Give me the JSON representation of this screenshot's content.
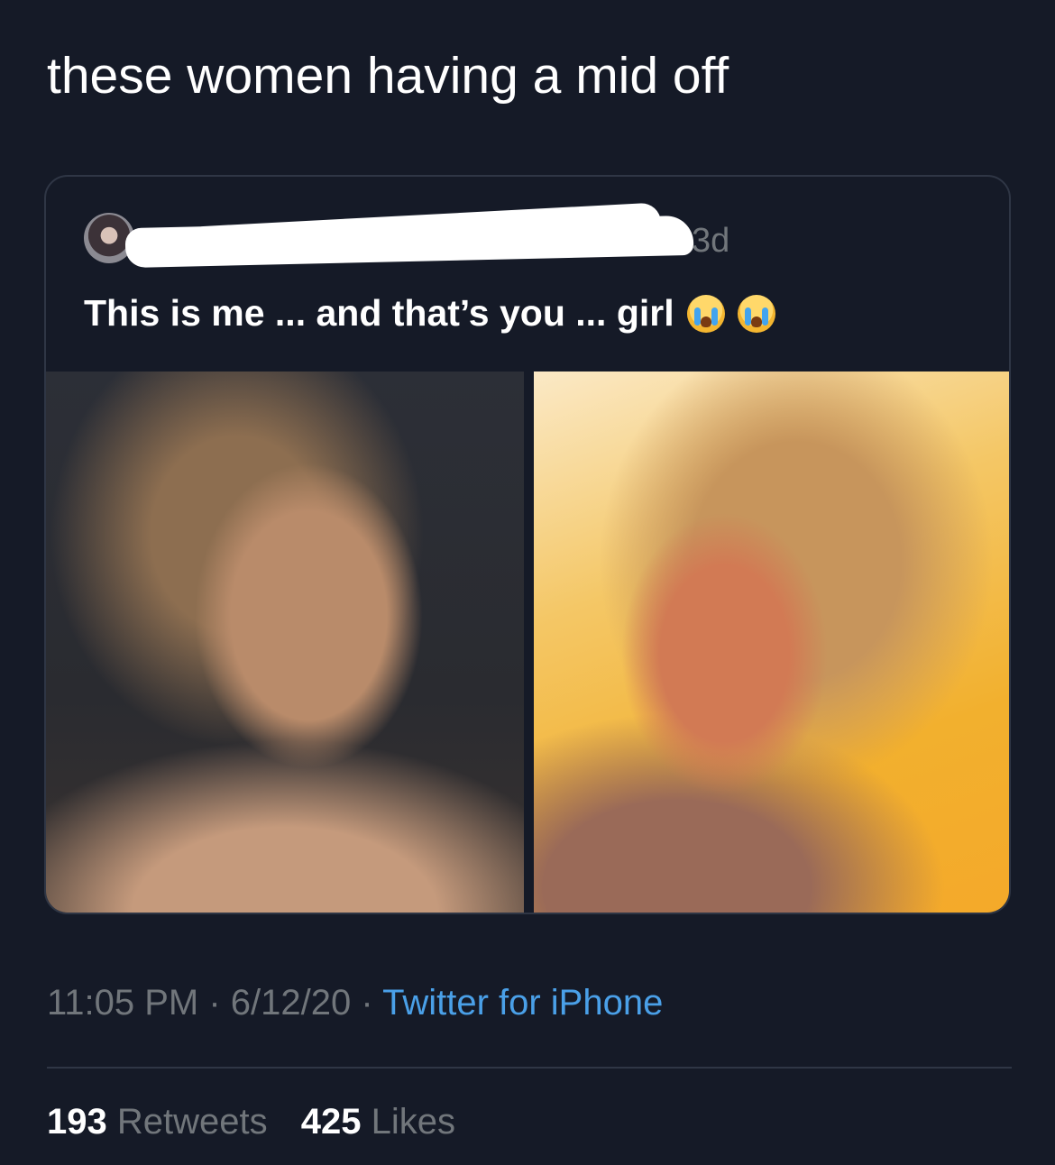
{
  "tweet": {
    "text": "these women having a mid off",
    "time": "11:05 PM",
    "date": "6/12/20",
    "source": "Twitter for iPhone",
    "separator": " · ",
    "retweets_count": "193",
    "retweets_label": "Retweets",
    "likes_count": "425",
    "likes_label": "Likes"
  },
  "quote_tweet": {
    "time_ago": "3d",
    "text": "This is me ... and that’s you ... girl",
    "emojis": [
      "loudly-crying-face-icon",
      "loudly-crying-face-icon"
    ],
    "author_name_redacted": true
  },
  "colors": {
    "background": "#151a27",
    "link": "#4aa0e8",
    "muted": "#71767b",
    "border": "#2f3645"
  }
}
